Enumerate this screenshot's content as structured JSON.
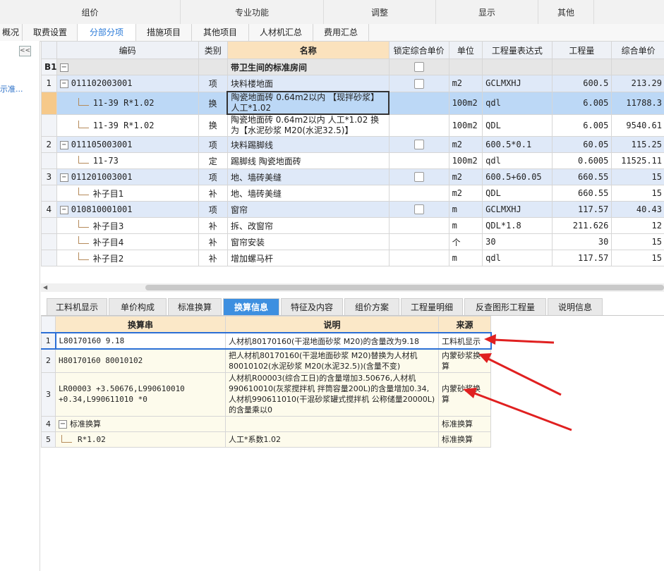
{
  "top_groups": [
    "组价",
    "专业功能",
    "调整",
    "显示",
    "其他"
  ],
  "main_tabs": [
    {
      "label": "概况",
      "active": false
    },
    {
      "label": "取费设置",
      "active": false
    },
    {
      "label": "分部分项",
      "active": true
    },
    {
      "label": "措施项目",
      "active": false
    },
    {
      "label": "其他项目",
      "active": false
    },
    {
      "label": "人材机汇总",
      "active": false
    },
    {
      "label": "费用汇总",
      "active": false
    }
  ],
  "left_panel": {
    "collapse_glyph": "<<",
    "link_text": "示准..."
  },
  "main_table": {
    "headers": [
      "",
      "编码",
      "类别",
      "名称",
      "锁定综合单价",
      "单位",
      "工程量表达式",
      "工程量",
      "综合单价"
    ],
    "group": {
      "index": "B1",
      "name": "带卫生间的标准房间"
    },
    "rows": [
      {
        "index": "1",
        "code": "011102003001",
        "type": "项",
        "name": "块料楼地面",
        "locked": true,
        "unit": "m2",
        "expr": "GCLMXHJ",
        "qty": "600.5",
        "price": "213.29"
      },
      {
        "index": "",
        "code": "11-39 R*1.02",
        "type": "换",
        "name": "陶瓷地面砖 0.64m2以内 【现拌砂浆】 人工*1.02",
        "locked": false,
        "unit": "100m2",
        "expr": "qdl",
        "qty": "6.005",
        "price": "11788.3"
      },
      {
        "index": "",
        "code": "11-39 R*1.02",
        "type": "换",
        "name": "陶瓷地面砖 0.64m2以内 人工*1.02 换为【水泥砂浆 M20(水泥32.5)】",
        "locked": false,
        "unit": "100m2",
        "expr": "QDL",
        "qty": "6.005",
        "price": "9540.61"
      },
      {
        "index": "2",
        "code": "011105003001",
        "type": "项",
        "name": "块料踢脚线",
        "locked": true,
        "unit": "m2",
        "expr": "600.5*0.1",
        "qty": "60.05",
        "price": "115.25"
      },
      {
        "index": "",
        "code": "11-73",
        "type": "定",
        "name": "踢脚线 陶瓷地面砖",
        "locked": false,
        "unit": "100m2",
        "expr": "qdl",
        "qty": "0.6005",
        "price": "11525.11"
      },
      {
        "index": "3",
        "code": "011201003001",
        "type": "项",
        "name": "地、墙砖美缝",
        "locked": true,
        "unit": "m2",
        "expr": "600.5+60.05",
        "qty": "660.55",
        "price": "15"
      },
      {
        "index": "",
        "code": "补子目1",
        "type": "补",
        "name": "地、墙砖美缝",
        "locked": false,
        "unit": "m2",
        "expr": "QDL",
        "qty": "660.55",
        "price": "15"
      },
      {
        "index": "4",
        "code": "010810001001",
        "type": "项",
        "name": "窗帘",
        "locked": true,
        "unit": "m",
        "expr": "GCLMXHJ",
        "qty": "117.57",
        "price": "40.43"
      },
      {
        "index": "",
        "code": "补子目3",
        "type": "补",
        "name": "拆、改窗帘",
        "locked": false,
        "unit": "m",
        "expr": "QDL*1.8",
        "qty": "211.626",
        "price": "12"
      },
      {
        "index": "",
        "code": "补子目4",
        "type": "补",
        "name": "窗帘安装",
        "locked": false,
        "unit": "个",
        "expr": "30",
        "qty": "30",
        "price": "15"
      },
      {
        "index": "",
        "code": "补子目2",
        "type": "补",
        "name": "增加螺马杆",
        "locked": false,
        "unit": "m",
        "expr": "qdl",
        "qty": "117.57",
        "price": "15"
      }
    ]
  },
  "bottom_tabs": [
    {
      "label": "工料机显示",
      "active": false
    },
    {
      "label": "单价构成",
      "active": false
    },
    {
      "label": "标准换算",
      "active": false
    },
    {
      "label": "换算信息",
      "active": true
    },
    {
      "label": "特征及内容",
      "active": false
    },
    {
      "label": "组价方案",
      "active": false
    },
    {
      "label": "工程量明细",
      "active": false
    },
    {
      "label": "反查图形工程量",
      "active": false
    },
    {
      "label": "说明信息",
      "active": false
    }
  ],
  "sub_table": {
    "headers": [
      "",
      "换算串",
      "说明",
      "来源"
    ],
    "rows": [
      {
        "index": "1",
        "str": "L80170160 9.18",
        "desc": "人材机80170160(干混地面砂浆 M20)的含量改为9.18",
        "source": "工料机显示"
      },
      {
        "index": "2",
        "str": "H80170160 80010102",
        "desc": "把人材机80170160(干混地面砂浆 M20)替换为人材机80010102(水泥砂浆 M20(水泥32.5))(含量不变)",
        "source": "内蒙砂浆换算"
      },
      {
        "index": "3",
        "str": "LR00003 +3.50676,L990610010 +0.34,L990611010 *0",
        "desc": "人材机R00003(综合工日)的含量增加3.50676,人材机990610010(灰浆搅拌机 拌筒容量200L)的含量增加0.34,人材机990611010(干混砂浆罐式搅拌机 公称储量20000L)的含量乘以0",
        "source": "内蒙砂浆换算"
      },
      {
        "index": "4",
        "str": "标准换算",
        "desc": "",
        "source": "标准换算"
      },
      {
        "index": "5",
        "str": "R*1.02",
        "desc": "人工*系数1.02",
        "source": "标准换算"
      }
    ]
  },
  "colors": {
    "accent": "#2a7ad8",
    "active_tab": "#3d8fe0",
    "arrow": "#e02020"
  }
}
